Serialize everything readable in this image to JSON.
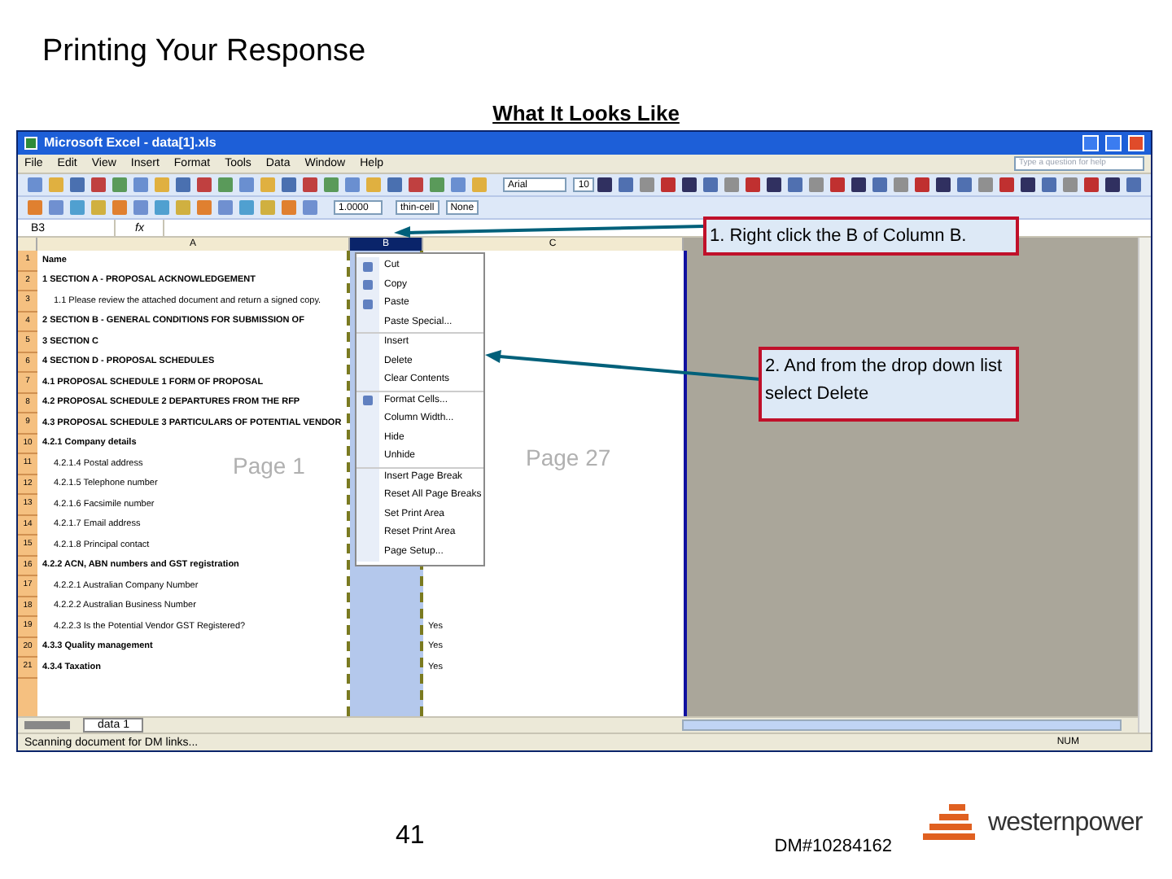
{
  "slide": {
    "title": "Printing Your Response",
    "subtitle": "What It Looks Like",
    "page_number": "41",
    "doc_id": "DM#10284162",
    "logo_text": "westernpower"
  },
  "excel": {
    "title": "Microsoft Excel - data[1].xls",
    "menu": [
      "File",
      "Edit",
      "View",
      "Insert",
      "Format",
      "Tools",
      "Data",
      "Window",
      "Help"
    ],
    "help_placeholder": "Type a question for help",
    "font": "Arial",
    "font_size": "10",
    "zoom_value": "1.0000",
    "style": "thin-cell",
    "style_none": "None",
    "name_box": "B3",
    "fx": "fx",
    "columns": [
      {
        "label": "A",
        "selected": false
      },
      {
        "label": "B",
        "selected": true
      },
      {
        "label": "C",
        "selected": false
      }
    ],
    "rows": [
      {
        "num": "1",
        "kind": "heading",
        "a": "Name"
      },
      {
        "num": "2",
        "kind": "heading",
        "a": "1 SECTION A - PROPOSAL ACKNOWLEDGEMENT"
      },
      {
        "num": "3",
        "kind": "text",
        "a": "1.1 Please review the attached document and return a signed copy."
      },
      {
        "num": "4",
        "kind": "heading",
        "a": "2 SECTION B - GENERAL CONDITIONS FOR SUBMISSION OF"
      },
      {
        "num": "5",
        "kind": "heading",
        "a": "3 SECTION C"
      },
      {
        "num": "6",
        "kind": "heading",
        "a": "4 SECTION D - PROPOSAL SCHEDULES"
      },
      {
        "num": "7",
        "kind": "heading",
        "a": "4.1 PROPOSAL SCHEDULE 1 FORM OF PROPOSAL"
      },
      {
        "num": "8",
        "kind": "heading",
        "a": "4.2 PROPOSAL SCHEDULE 2 DEPARTURES FROM THE RFP"
      },
      {
        "num": "9",
        "kind": "heading",
        "a": "4.3 PROPOSAL SCHEDULE 3 PARTICULARS OF POTENTIAL VENDOR"
      },
      {
        "num": "10",
        "kind": "heading",
        "a": "4.2.1 Company details"
      },
      {
        "num": "11",
        "kind": "text",
        "a": "4.2.1.4 Postal address"
      },
      {
        "num": "12",
        "kind": "text",
        "a": "4.2.1.5 Telephone number"
      },
      {
        "num": "13",
        "kind": "text",
        "a": "4.2.1.6 Facsimile number"
      },
      {
        "num": "14",
        "kind": "text",
        "a": "4.2.1.7 Email address"
      },
      {
        "num": "15",
        "kind": "text",
        "a": "4.2.1.8 Principal contact"
      },
      {
        "num": "16",
        "kind": "heading",
        "a": "4.2.2 ACN, ABN numbers and GST registration"
      },
      {
        "num": "17",
        "kind": "text",
        "a": "4.2.2.1 Australian Company Number"
      },
      {
        "num": "18",
        "kind": "text",
        "a": "4.2.2.2 Australian Business Number"
      },
      {
        "num": "19",
        "kind": "text",
        "a": "4.2.2.3 Is the Potential Vendor GST Registered?",
        "c": "Yes"
      },
      {
        "num": "20",
        "kind": "heading",
        "a": "4.3.3 Quality management",
        "c": "Yes"
      },
      {
        "num": "21",
        "kind": "heading",
        "a": "4.3.4 Taxation",
        "c": "Yes"
      }
    ],
    "page_labels": [
      "Page 1",
      "Page 27"
    ],
    "context_menu": [
      {
        "label": "Cut",
        "has_icon": true,
        "divider_before": false
      },
      {
        "label": "Copy",
        "has_icon": true,
        "divider_before": false
      },
      {
        "label": "Paste",
        "has_icon": true,
        "divider_before": false
      },
      {
        "label": "Paste Special...",
        "has_icon": false,
        "divider_before": false
      },
      {
        "label": "Insert",
        "has_icon": false,
        "divider_before": true
      },
      {
        "label": "Delete",
        "has_icon": false,
        "divider_before": false
      },
      {
        "label": "Clear Contents",
        "has_icon": false,
        "divider_before": false
      },
      {
        "label": "Format Cells...",
        "has_icon": true,
        "divider_before": true
      },
      {
        "label": "Column Width...",
        "has_icon": false,
        "divider_before": false
      },
      {
        "label": "Hide",
        "has_icon": false,
        "divider_before": false
      },
      {
        "label": "Unhide",
        "has_icon": false,
        "divider_before": false
      },
      {
        "label": "Insert Page Break",
        "has_icon": false,
        "divider_before": true
      },
      {
        "label": "Reset All Page Breaks",
        "has_icon": false,
        "divider_before": false
      },
      {
        "label": "Set Print Area",
        "has_icon": false,
        "divider_before": false
      },
      {
        "label": "Reset Print Area",
        "has_icon": false,
        "divider_before": false
      },
      {
        "label": "Page Setup...",
        "has_icon": false,
        "divider_before": false
      }
    ],
    "sheet_tab": "data 1",
    "status": "Scanning document for DM links...",
    "num": "NUM"
  },
  "callouts": [
    "1. Right click the B of Column B.",
    "2. And from the drop down list select Delete"
  ]
}
